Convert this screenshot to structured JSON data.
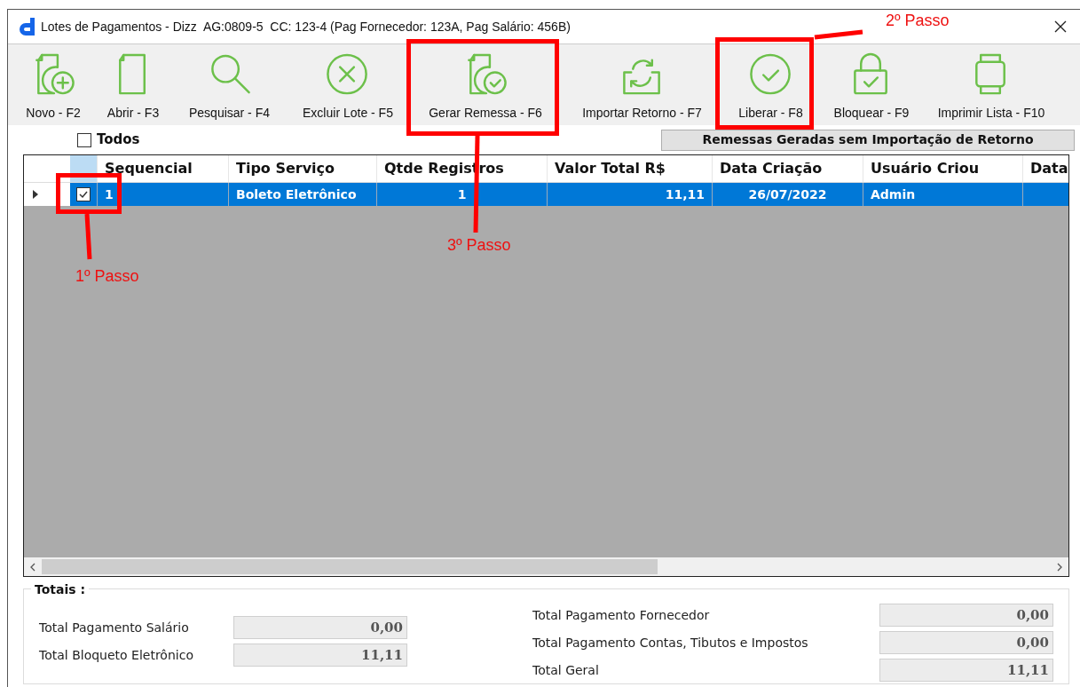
{
  "window": {
    "title": "Lotes de Pagamentos - Dizz  AG:0809-5  CC: 123-4 (Pag Fornecedor: 123A, Pag Salário: 456B)"
  },
  "toolbar": [
    {
      "label": "Novo - F2"
    },
    {
      "label": "Abrir - F3"
    },
    {
      "label": "Pesquisar - F4"
    },
    {
      "label": "Excluir Lote - F5"
    },
    {
      "label": "Gerar Remessa - F6"
    },
    {
      "label": "Importar Retorno - F7"
    },
    {
      "label": "Liberar - F8"
    },
    {
      "label": "Bloquear - F9"
    },
    {
      "label": "Imprimir Lista - F10"
    }
  ],
  "select_all": {
    "label": "Todos",
    "checked": false
  },
  "remessas_button": "Remessas Geradas sem Importação de Retorno",
  "table": {
    "columns": [
      "Sequencial",
      "Tipo Serviço",
      "Qtde Registros",
      "Valor Total R$",
      "Data Criação",
      "Usuário Criou",
      "Data"
    ],
    "rows": [
      {
        "selected": true,
        "checked": true,
        "cells": [
          "1",
          "Boleto Eletrônico",
          "1",
          "11,11",
          "26/07/2022",
          "Admin",
          ""
        ]
      }
    ]
  },
  "totals": {
    "title": "Totais :",
    "left": [
      {
        "label": "Total Pagamento Salário",
        "value": "0,00"
      },
      {
        "label": "Total Bloqueto Eletrônico",
        "value": "11,11"
      }
    ],
    "right": [
      {
        "label": "Total Pagamento Fornecedor",
        "value": "0,00"
      },
      {
        "label": "Total Pagamento Contas, Tibutos e Impostos",
        "value": "0,00"
      },
      {
        "label": "Total Geral",
        "value": "11,11"
      }
    ]
  },
  "annotations": [
    {
      "text": "1º Passo"
    },
    {
      "text": "2º Passo"
    },
    {
      "text": "3º Passo"
    }
  ]
}
